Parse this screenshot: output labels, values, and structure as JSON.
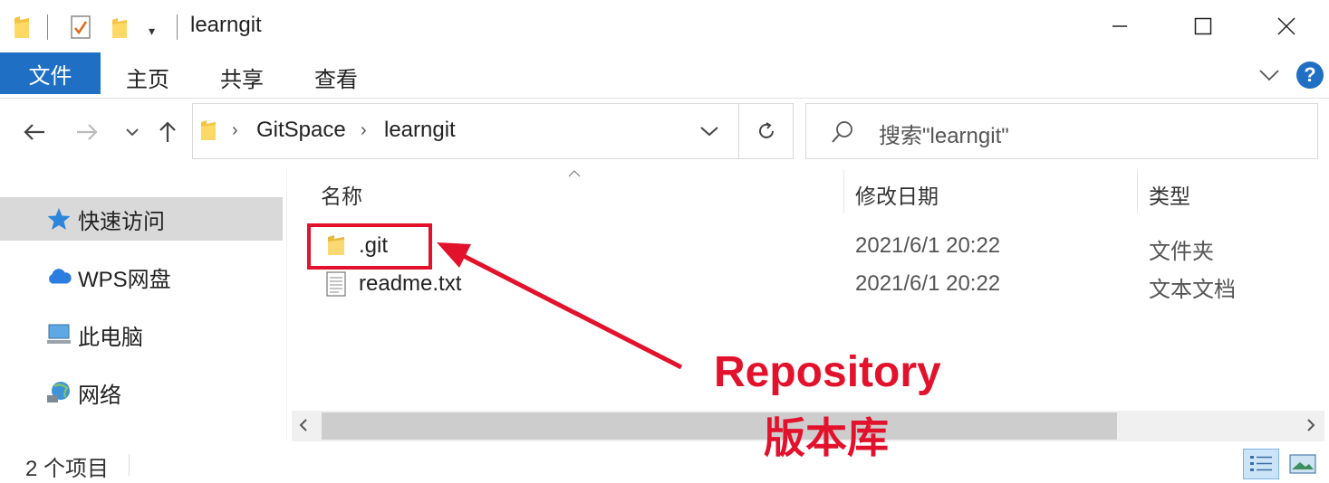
{
  "window": {
    "title": "learngit",
    "quick_access_dropdown": "▾"
  },
  "ribbon": {
    "tabs": [
      "文件",
      "主页",
      "共享",
      "查看"
    ],
    "help": "?"
  },
  "address": {
    "crumbs": [
      "GitSpace",
      "learngit"
    ],
    "search_placeholder": "搜索\"learngit\""
  },
  "sidebar": {
    "items": [
      {
        "label": "快速访问",
        "icon": "star-icon",
        "selected": true
      },
      {
        "label": "WPS网盘",
        "icon": "cloud-icon",
        "selected": false
      },
      {
        "label": "此电脑",
        "icon": "computer-icon",
        "selected": false
      },
      {
        "label": "网络",
        "icon": "network-icon",
        "selected": false
      }
    ]
  },
  "columns": [
    "名称",
    "修改日期",
    "类型"
  ],
  "files": [
    {
      "name": ".git",
      "modified": "2021/6/1 20:22",
      "type": "文件夹",
      "icon": "folder-icon"
    },
    {
      "name": "readme.txt",
      "modified": "2021/6/1 20:22",
      "type": "文本文档",
      "icon": "text-file-icon"
    }
  ],
  "status": {
    "item_count": "2 个项目"
  },
  "annotation": {
    "line1": "Repository",
    "line2": "版本库",
    "color": "#e3122c"
  },
  "colors": {
    "accent": "#1f6fc4",
    "selected_bg": "#d9d9d9"
  }
}
